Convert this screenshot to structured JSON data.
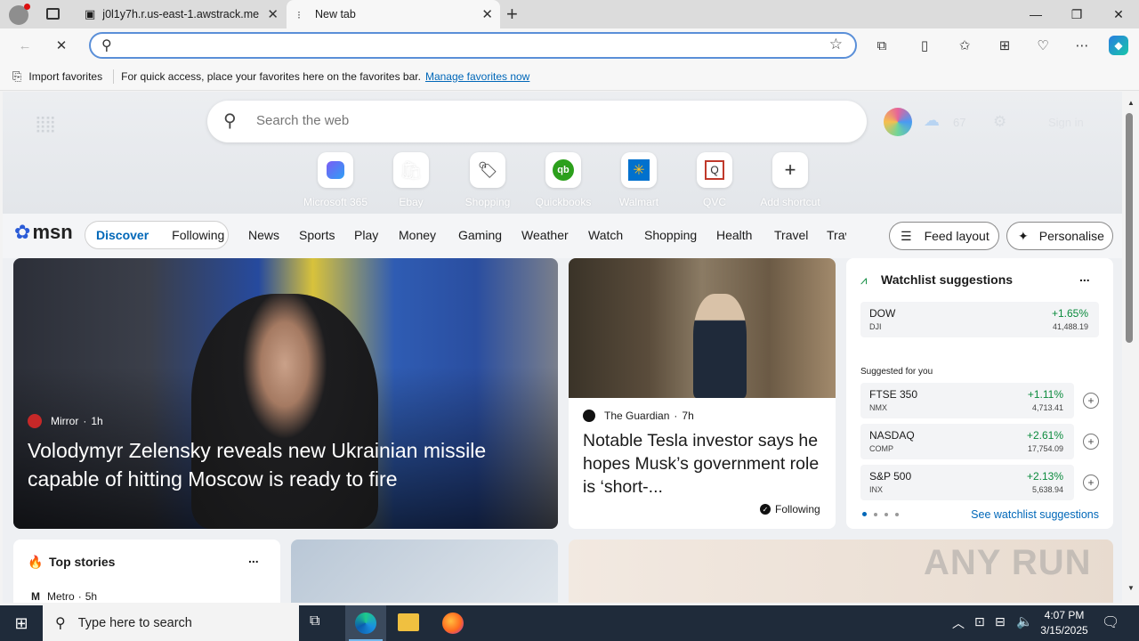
{
  "browser": {
    "tabs": [
      {
        "title": "j0l1y7h.r.us-east-1.awstrack.me"
      },
      {
        "title": "New tab"
      }
    ],
    "new_tab_symbol": "+",
    "favorites_bar": {
      "import_label": "Import favorites",
      "hint": "For quick access, place your favorites here on the favorites bar.",
      "manage_link": "Manage favorites now"
    }
  },
  "newtab": {
    "search_placeholder": "Search the web",
    "weather_temp": "67",
    "sign_in": "Sign in",
    "shortcuts": [
      {
        "label": "Microsoft 365",
        "icon": "microsoft365-icon"
      },
      {
        "label": "Ebay",
        "icon": "ebay-icon"
      },
      {
        "label": "Shopping",
        "icon": "tag-icon"
      },
      {
        "label": "Quickbooks",
        "icon": "quickbooks-icon"
      },
      {
        "label": "Walmart",
        "icon": "walmart-icon"
      },
      {
        "label": "QVC",
        "icon": "qvc-icon"
      },
      {
        "label": "Add shortcut",
        "icon": "plus-icon"
      }
    ],
    "msn_logo": "msn",
    "feed_tabs": [
      "Discover",
      "Following"
    ],
    "categories": [
      "News",
      "Sports",
      "Play",
      "Money",
      "Gaming",
      "Weather",
      "Watch",
      "Shopping",
      "Health",
      "Travel",
      "Trav"
    ],
    "feed_layout_label": "Feed layout",
    "personalise_label": "Personalise",
    "hero_story": {
      "source": "Mirror",
      "age": "1h",
      "headline": "Volodymyr Zelensky reveals new Ukrainian missile capable of hitting Moscow is ready to fire"
    },
    "second_story": {
      "source": "The Guardian",
      "age": "7h",
      "headline": "Notable Tesla investor says he hopes Musk’s government role is ‘short-...",
      "follow_label": "Following"
    },
    "watchlist": {
      "title": "Watchlist suggestions",
      "more": "...",
      "primary": {
        "symbol": "DOW",
        "exchange": "DJI",
        "change": "+1.65%",
        "value": "41,488.19"
      },
      "suggested_label": "Suggested for you",
      "suggestions": [
        {
          "symbol": "FTSE 350",
          "exchange": "NMX",
          "change": "+1.11%",
          "value": "4,713.41"
        },
        {
          "symbol": "NASDAQ",
          "exchange": "COMP",
          "change": "+2.61%",
          "value": "17,754.09"
        },
        {
          "symbol": "S&P 500",
          "exchange": "INX",
          "change": "+2.13%",
          "value": "5,638.94"
        }
      ],
      "see_link": "See watchlist suggestions"
    },
    "top_stories": {
      "title": "Top stories",
      "more": "...",
      "first_source": "Metro",
      "first_age": "5h"
    }
  },
  "taskbar": {
    "search_placeholder": "Type here to search",
    "time": "4:07 PM",
    "date": "3/15/2025"
  },
  "watermark": "ANY RUN",
  "colors": {
    "accent": "#0067b8",
    "positive": "#0a8a3c",
    "taskbar": "#1f2b3a"
  }
}
